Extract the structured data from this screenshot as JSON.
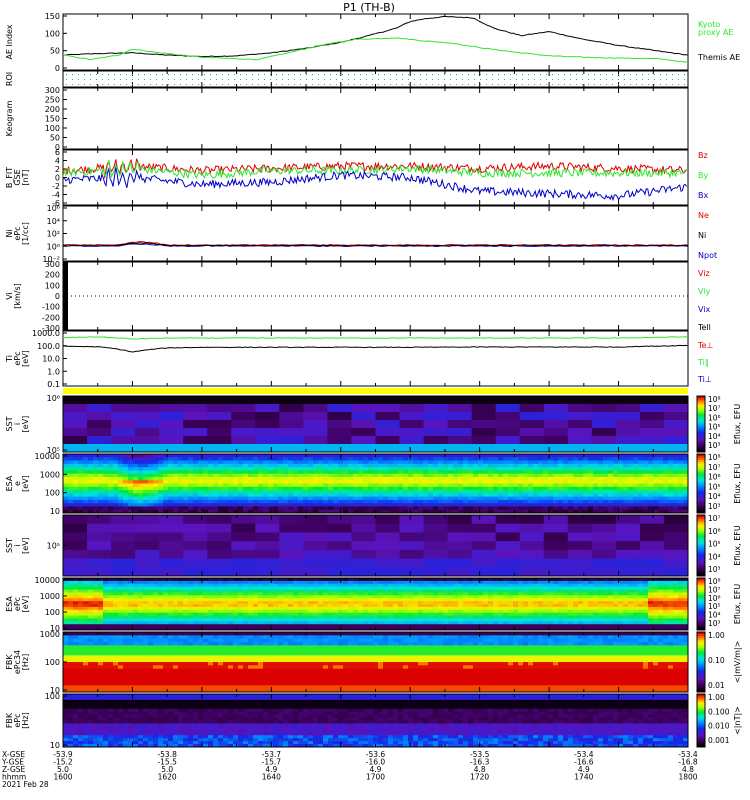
{
  "title": "P1 (TH-B)",
  "date_label": "2021 Feb 28",
  "colors": {
    "black": "#000000",
    "green": "#2ee62e",
    "red": "#e00000",
    "blue": "#0000c8",
    "grid": "#000000",
    "roi_dots": "#20b0b0",
    "yellow": "#ffff00"
  },
  "panels": {
    "ae": {
      "ylabel": "AE Index",
      "ticks": [
        "150",
        "100",
        "50",
        "0"
      ],
      "legend": [
        {
          "label": "Kyoto",
          "color": "green"
        },
        {
          "label": "proxy AE",
          "color": "green"
        },
        {
          "label": "Themis AE",
          "color": "black"
        }
      ]
    },
    "roi": {
      "ylabel": "ROI"
    },
    "keogram": {
      "ylabel": "Keogram",
      "ticks": [
        "300",
        "250",
        "200",
        "150",
        "100",
        "50",
        "0"
      ]
    },
    "bfield": {
      "ylabel": [
        "B_FIT",
        "GSE",
        "[nT]"
      ],
      "ticks": [
        "6",
        "4",
        "2",
        "0",
        "-2",
        "-4",
        "-6"
      ],
      "legend": [
        {
          "label": "Bz",
          "color": "red"
        },
        {
          "label": "By",
          "color": "green"
        },
        {
          "label": "Bx",
          "color": "blue"
        }
      ]
    },
    "density": {
      "ylabel": [
        "Ni",
        "ePc",
        "[1/cc]"
      ],
      "ticks": [
        "10⁶",
        "10⁴",
        "10²",
        "10⁰",
        "10⁻²"
      ],
      "legend": [
        {
          "label": "Ne",
          "color": "red"
        },
        {
          "label": "Ni",
          "color": "black"
        },
        {
          "label": "Npot",
          "color": "blue"
        }
      ]
    },
    "velocity": {
      "ylabel": [
        "Vi",
        "[km/s]"
      ],
      "ticks": [
        "300",
        "200",
        "100",
        "0",
        "-100",
        "-200",
        "-300"
      ],
      "legend": [
        {
          "label": "Viz",
          "color": "red"
        },
        {
          "label": "Viy",
          "color": "green"
        },
        {
          "label": "Vix",
          "color": "blue"
        },
        {
          "label": "Tell",
          "color": "black"
        }
      ]
    },
    "temperature": {
      "ylabel": [
        "Ti",
        "ePc",
        "[eV]"
      ],
      "ticks": [
        "1000.0",
        "100.0",
        "10.0",
        "1.0",
        "0.1"
      ],
      "legend": [
        {
          "label": "Te⊥",
          "color": "red"
        },
        {
          "label": "Ti∥",
          "color": "green"
        },
        {
          "label": "Ti⊥",
          "color": "blue"
        }
      ]
    },
    "spectrograms": [
      {
        "ylabel": [
          "SST",
          "i",
          "[eV]"
        ],
        "ticks": [
          "10⁶",
          "10⁵"
        ],
        "kind": "sst_e"
      },
      {
        "ylabel": [
          "ESA",
          "e",
          "[eV]"
        ],
        "ticks": [
          "10000",
          "1000",
          "100",
          "10"
        ],
        "kind": "esa_e"
      },
      {
        "ylabel": [
          "SST",
          "i",
          "[eV]"
        ],
        "ticks": [
          "10⁵"
        ],
        "kind": "sst_i"
      },
      {
        "ylabel": [
          "ESA",
          "ePc",
          "[eV]"
        ],
        "ticks": [
          "10000",
          "1000",
          "100",
          "10"
        ],
        "kind": "esa_i"
      },
      {
        "ylabel": [
          "FBK",
          "ePc34",
          "[Hz]"
        ],
        "ticks": [
          "1000",
          "100",
          "10"
        ],
        "kind": "fbk1"
      },
      {
        "ylabel": [
          "FBK",
          "ePc",
          "[Hz]"
        ],
        "ticks": [
          "100",
          "10"
        ],
        "kind": "fbk2"
      }
    ]
  },
  "colorbars": [
    {
      "ticks": [
        "10⁸",
        "10⁷",
        "10⁶",
        "10⁵",
        "10⁴",
        "10³"
      ],
      "label": "Eflux, EFU"
    },
    {
      "ticks": [
        "10⁸",
        "10⁷",
        "10⁶",
        "10⁵",
        "10⁴",
        "10³"
      ],
      "label": "Eflux, EFU"
    },
    {
      "ticks": [
        "10⁷",
        "10⁶",
        "10⁵",
        "10⁴",
        "10³"
      ],
      "label": "Eflux, EFU"
    },
    {
      "ticks": [
        "10⁸",
        "10⁷",
        "10⁶",
        "10⁵",
        "10⁴",
        "10³"
      ],
      "label": "Eflux, EFU"
    },
    {
      "ticks": [
        "1.00",
        "0.10",
        "0.01"
      ],
      "label": "<|mV/m|>"
    },
    {
      "ticks": [
        "1.00",
        "0.100",
        "0.010",
        "0.001"
      ],
      "label": "<|nT|>"
    }
  ],
  "axis_rows": {
    "labels": [
      "X-GSE",
      "Y-GSE",
      "Z-GSE",
      "hhmm"
    ],
    "columns": [
      [
        "-53.9",
        "-15.2",
        "5.0",
        "1600"
      ],
      [
        "-53.8",
        "-15.5",
        "5.0",
        "1620"
      ],
      [
        "-53.7",
        "-15.7",
        "4.9",
        "1640"
      ],
      [
        "-53.6",
        "-16.0",
        "4.9",
        "1700"
      ],
      [
        "-53.5",
        "-16.3",
        "4.8",
        "1720"
      ],
      [
        "-53.4",
        "-16.6",
        "4.9",
        "1740"
      ],
      [
        "-53.4",
        "-16.8",
        "4.8",
        "1800"
      ]
    ]
  },
  "chart_data": [
    {
      "type": "line",
      "title": "P1 (TH-B)",
      "ylabel": "AE Index",
      "x_unit": "minutes after 1600 UT",
      "ylim": [
        0,
        150
      ],
      "series": [
        {
          "name": "Themis AE",
          "x": [
            0,
            10,
            20,
            30,
            40,
            50,
            60,
            70,
            80,
            88,
            96,
            100,
            104,
            110,
            118,
            124,
            132,
            140,
            150,
            160,
            172,
            180
          ],
          "y": [
            40,
            44,
            46,
            40,
            36,
            38,
            46,
            58,
            74,
            92,
            112,
            130,
            137,
            143,
            140,
            112,
            92,
            103,
            82,
            66,
            50,
            40
          ]
        },
        {
          "name": "Kyoto proxy AE",
          "x": [
            0,
            8,
            16,
            20,
            28,
            40,
            56,
            64,
            74,
            84,
            96,
            104,
            112,
            120,
            130,
            140,
            150,
            160,
            172,
            180
          ],
          "y": [
            40,
            28,
            40,
            56,
            46,
            34,
            28,
            44,
            66,
            82,
            86,
            78,
            72,
            60,
            48,
            38,
            34,
            32,
            30,
            20
          ]
        }
      ]
    },
    {
      "type": "line",
      "ylabel": "B_FIT GSE [nT]",
      "ylim": [
        -6,
        6
      ],
      "series": [
        {
          "name": "Bz",
          "x": [
            0,
            20,
            40,
            60,
            80,
            100,
            120,
            140,
            160,
            180
          ],
          "y": [
            1.5,
            2.5,
            1.5,
            2.0,
            2.5,
            2.5,
            2.0,
            2.5,
            2.0,
            1.5
          ]
        },
        {
          "name": "By",
          "x": [
            0,
            20,
            40,
            60,
            80,
            100,
            120,
            140,
            160,
            180
          ],
          "y": [
            1.0,
            2.0,
            0.5,
            1.5,
            1.5,
            2.0,
            1.0,
            1.0,
            1.0,
            1.0
          ]
        },
        {
          "name": "Bx",
          "x": [
            0,
            20,
            40,
            60,
            80,
            100,
            120,
            140,
            160,
            180
          ],
          "y": [
            -0.5,
            0.0,
            -1.5,
            -1.0,
            0.5,
            0.0,
            -3.0,
            -3.5,
            -4.0,
            -2.0
          ]
        }
      ]
    },
    {
      "type": "line",
      "ylabel": "Ti ePc [eV]",
      "ylim": [
        0.1,
        1000
      ],
      "yscale": "log",
      "series": [
        {
          "name": "Ti∥",
          "x": [
            0,
            10,
            20,
            30,
            40,
            60,
            80,
            100,
            120,
            140,
            160,
            180
          ],
          "y": [
            600,
            700,
            450,
            550,
            550,
            550,
            550,
            550,
            550,
            550,
            550,
            700
          ]
        },
        {
          "name": "Te⊥",
          "x": [
            0,
            10,
            20,
            30,
            40,
            60,
            80,
            100,
            120,
            140,
            160,
            180
          ],
          "y": [
            110,
            100,
            35,
            80,
            90,
            90,
            90,
            90,
            95,
            95,
            95,
            130
          ]
        }
      ]
    }
  ]
}
